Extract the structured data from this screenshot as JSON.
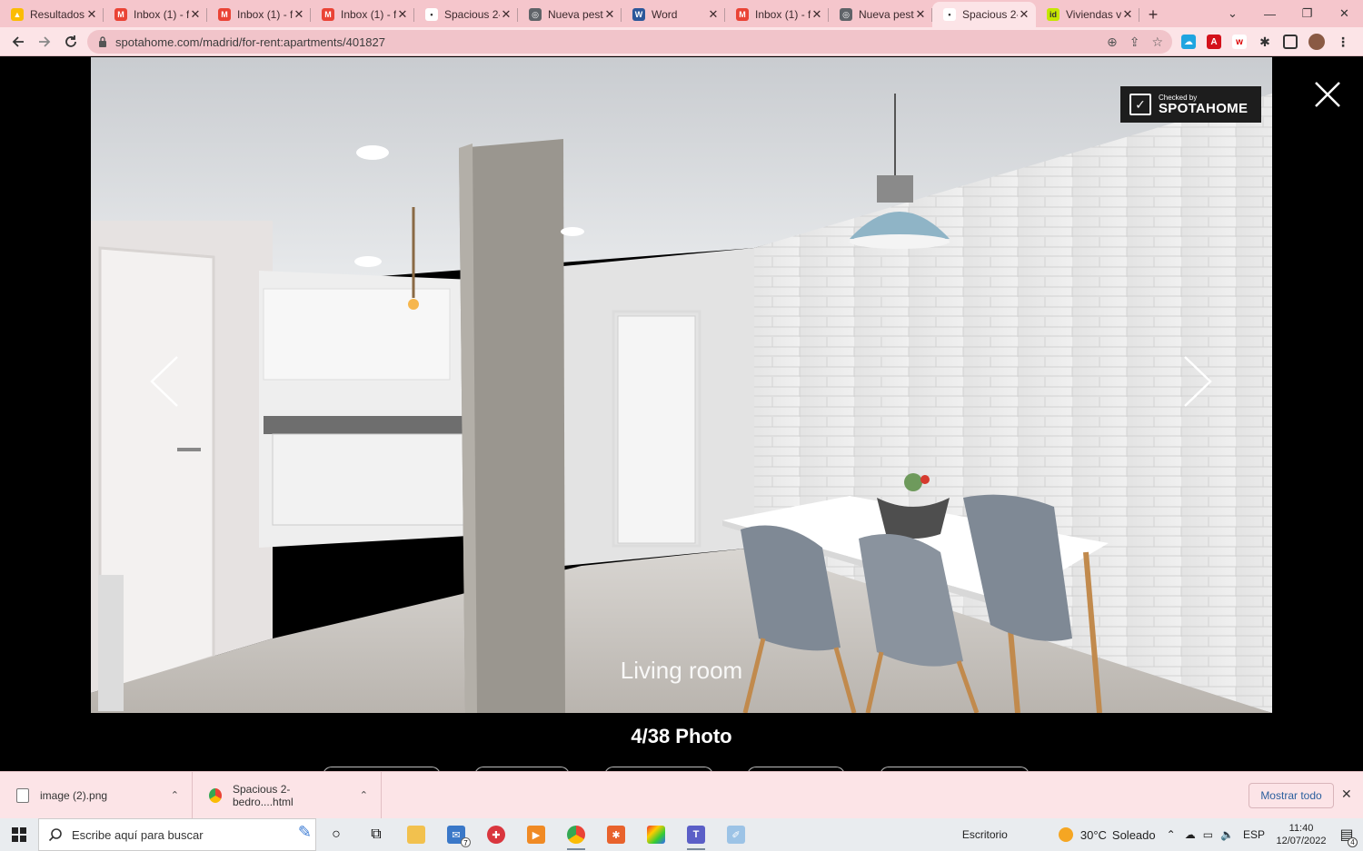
{
  "browser": {
    "tabs": [
      {
        "title": "Resultados",
        "icon": "google-ads-icon",
        "color": "#fbbc04",
        "glyph": "▲"
      },
      {
        "title": "Inbox (1) - f",
        "icon": "gmail-icon",
        "color": "#ea4335",
        "glyph": "M"
      },
      {
        "title": "Inbox (1) - f",
        "icon": "gmail-icon",
        "color": "#ea4335",
        "glyph": "M"
      },
      {
        "title": "Inbox (1) - f",
        "icon": "gmail-icon",
        "color": "#ea4335",
        "glyph": "M"
      },
      {
        "title": "Spacious 2-",
        "icon": "spotahome-icon",
        "color": "#ffffff",
        "glyph": "•"
      },
      {
        "title": "Nueva pest",
        "icon": "globe-icon",
        "color": "#5f6368",
        "glyph": "◎"
      },
      {
        "title": "Word",
        "icon": "word-icon",
        "color": "#2b579a",
        "glyph": "W"
      },
      {
        "title": "Inbox (1) - f",
        "icon": "gmail-icon",
        "color": "#ea4335",
        "glyph": "M"
      },
      {
        "title": "Nueva pest",
        "icon": "globe-icon",
        "color": "#5f6368",
        "glyph": "◎"
      },
      {
        "title": "Spacious 2-",
        "icon": "spotahome-icon",
        "color": "#ffffff",
        "glyph": "•",
        "active": true
      },
      {
        "title": "Viviendas v",
        "icon": "idealista-icon",
        "color": "#c5e600",
        "glyph": "id"
      }
    ],
    "address": "spotahome.com/madrid/for-rent:apartments/401827"
  },
  "viewer": {
    "caption": "Living room",
    "counter": "4/38 Photo",
    "badge_small": "Checked by",
    "badge_big": "SPOTAHOME"
  },
  "downloads": {
    "items": [
      {
        "name": "image (2).png"
      },
      {
        "name": "Spacious 2-bedro....html"
      }
    ],
    "show_all": "Mostrar todo"
  },
  "taskbar": {
    "search_placeholder": "Escribe aquí para buscar",
    "desktop_label": "Escritorio",
    "temperature": "30°C",
    "weather": "Soleado",
    "language": "ESP",
    "time": "11:40",
    "date": "12/07/2022",
    "notifications": "4",
    "mail_badge": "7"
  }
}
